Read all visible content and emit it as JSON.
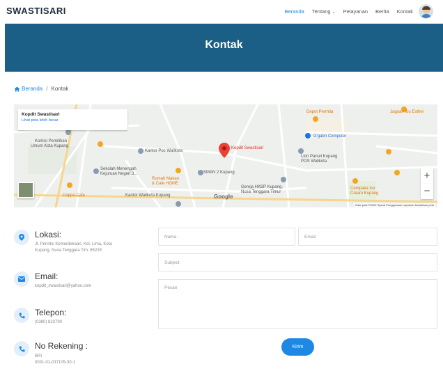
{
  "header": {
    "logo": "SWASTISARI",
    "nav": [
      {
        "label": "Beranda",
        "active": true
      },
      {
        "label": "Tentang",
        "dropdown": true
      },
      {
        "label": "Pelayanan"
      },
      {
        "label": "Berita"
      },
      {
        "label": "Kontak"
      }
    ]
  },
  "banner": {
    "title": "Kontak"
  },
  "breadcrumb": {
    "home": "Beranda",
    "separator": "/",
    "current": "Kontak"
  },
  "map": {
    "card_title": "Kopdit Swastisari",
    "card_link": "Lihat peta lebih besar",
    "marker_label": "Kopdit Swastisari",
    "labels": [
      "Depot Permita",
      "Jagoan Ibu Esther",
      "G'gabri Computer",
      "Lion Parcel Kupang",
      "POS Walikota",
      "Komisi Pemilihan",
      "Umum Kota Kupang",
      "Kantor Pos Walikota",
      "Sekolah Menengah",
      "Kejuruan Negeri 3...",
      "Rumah Makan",
      "& Cafe HOME",
      "SMAN 2 Kupang",
      "Gereja HKBP Kupang,",
      "Nusa Tenggara Timur",
      "Kantor Walikota Kupang",
      "Cempaka Ice",
      "Cream Kupang",
      "Coppa Cafe"
    ],
    "google": "Google",
    "attribution": "Data peta ©2022   Syarat Penggunaan   Laporkan kesalahan peta"
  },
  "contact": {
    "location": {
      "title": "Lokasi:",
      "lines": [
        "Jl. Perintis Kemerdekaan, Kel. Lima, Kota",
        "Kupang, Nusa Tenggara Tim. 85228"
      ]
    },
    "email": {
      "title": "Email:",
      "value": "kopdit_swastisari@yahoo.com"
    },
    "phone": {
      "title": "Telepon:",
      "value": "(0380) 823790"
    },
    "account": {
      "title": "No Rekening :",
      "lines": [
        "BRI",
        "0031-01-037105-30-1"
      ]
    }
  },
  "form": {
    "name_placeholder": "Nama",
    "email_placeholder": "Email",
    "subject_placeholder": "Subject",
    "message_placeholder": "Pesan",
    "submit": "Kirim"
  },
  "colors": {
    "banner": "#1b5e86",
    "accent": "#1e88e5"
  }
}
